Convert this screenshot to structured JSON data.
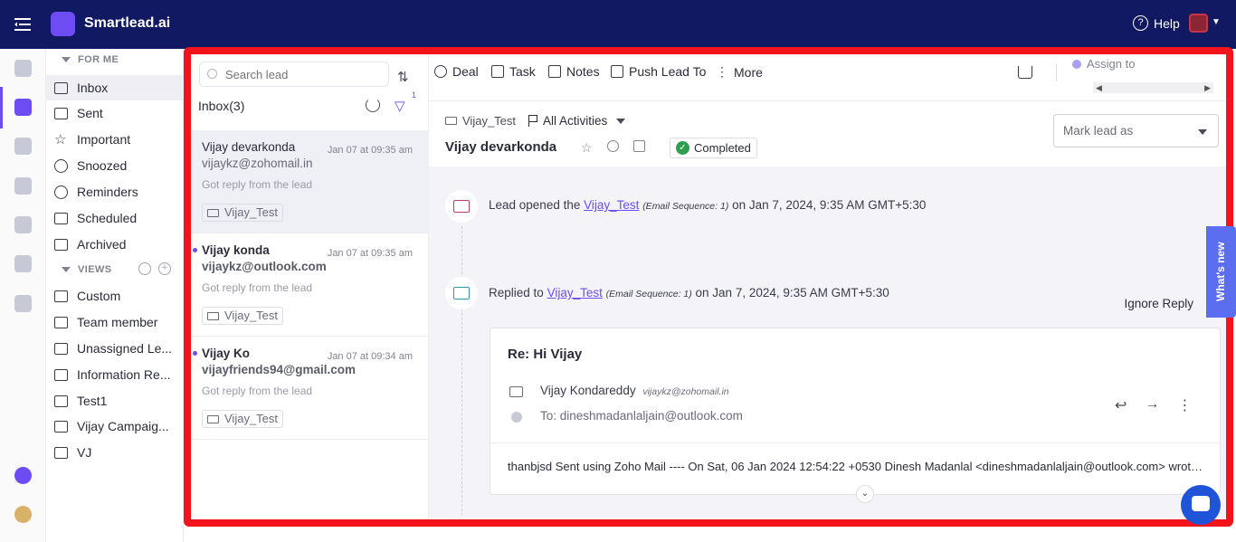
{
  "app": {
    "name": "Smartlead.ai",
    "help_label": "Help"
  },
  "sidebar": {
    "for_me_label": "FOR ME",
    "views_label": "VIEWS",
    "for_me_items": [
      {
        "label": "Inbox",
        "icon": "inbox-icon"
      },
      {
        "label": "Sent",
        "icon": "send-icon"
      },
      {
        "label": "Important",
        "icon": "star-icon"
      },
      {
        "label": "Snoozed",
        "icon": "alarm-icon"
      },
      {
        "label": "Reminders",
        "icon": "clock-icon"
      },
      {
        "label": "Scheduled",
        "icon": "scheduled-send-icon"
      },
      {
        "label": "Archived",
        "icon": "archive-icon"
      }
    ],
    "views_items": [
      {
        "label": "Custom"
      },
      {
        "label": "Team member"
      },
      {
        "label": "Unassigned Le..."
      },
      {
        "label": "Information Re..."
      },
      {
        "label": "Test1"
      },
      {
        "label": "Vijay Campaig..."
      },
      {
        "label": "VJ"
      }
    ]
  },
  "lead_list": {
    "search_placeholder": "Search lead",
    "title": "Inbox(3)",
    "filter_count": "1",
    "leads": [
      {
        "name": "Vijay devarkonda",
        "email": "vijaykz@zohomail.in",
        "time": "Jan 07 at 09:35 am",
        "snippet": "Got reply from the lead",
        "campaign": "Vijay_Test"
      },
      {
        "name": "Vijay konda",
        "email": "vijaykz@outlook.com",
        "time": "Jan 07 at 09:35 am",
        "snippet": "Got reply from the lead",
        "campaign": "Vijay_Test"
      },
      {
        "name": "Vijay Ko",
        "email": "vijayfriends94@gmail.com",
        "time": "Jan 07 at 09:34 am",
        "snippet": "Got reply from the lead",
        "campaign": "Vijay_Test"
      }
    ]
  },
  "toolbar": {
    "deal": "Deal",
    "task": "Task",
    "notes": "Notes",
    "push_lead": "Push Lead To",
    "more": "More",
    "assign_to": "Assign to"
  },
  "lead_detail": {
    "campaign": "Vijay_Test",
    "activities_filter": "All Activities",
    "name": "Vijay devarkonda",
    "status": "Completed",
    "mark_lead_placeholder": "Mark lead as"
  },
  "timeline": {
    "opened": {
      "prefix": "Lead opened the",
      "campaign": "Vijay_Test",
      "sequence": "(Email Sequence: 1)",
      "suffix": "on Jan 7, 2024, 9:35 AM GMT+5:30"
    },
    "replied": {
      "prefix": "Replied to",
      "campaign": "Vijay_Test",
      "sequence": "(Email Sequence: 1)",
      "suffix": "on Jan 7, 2024, 9:35 AM GMT+5:30",
      "ignore_label": "Ignore Reply"
    }
  },
  "email": {
    "subject": "Re: Hi Vijay",
    "sender_name": "Vijay Kondareddy",
    "sender_email": "vijaykz@zohomail.in",
    "to": "To: dineshmadanlaljain@outlook.com",
    "body": "thanbjsd Sent using Zoho Mail ---- On Sat, 06 Jan 2024 12:54:22 +0530 Dinesh Madanlal <dineshmadanlaljain@outlook.com> wrote ---"
  },
  "widgets": {
    "whats_new": "What's new"
  }
}
